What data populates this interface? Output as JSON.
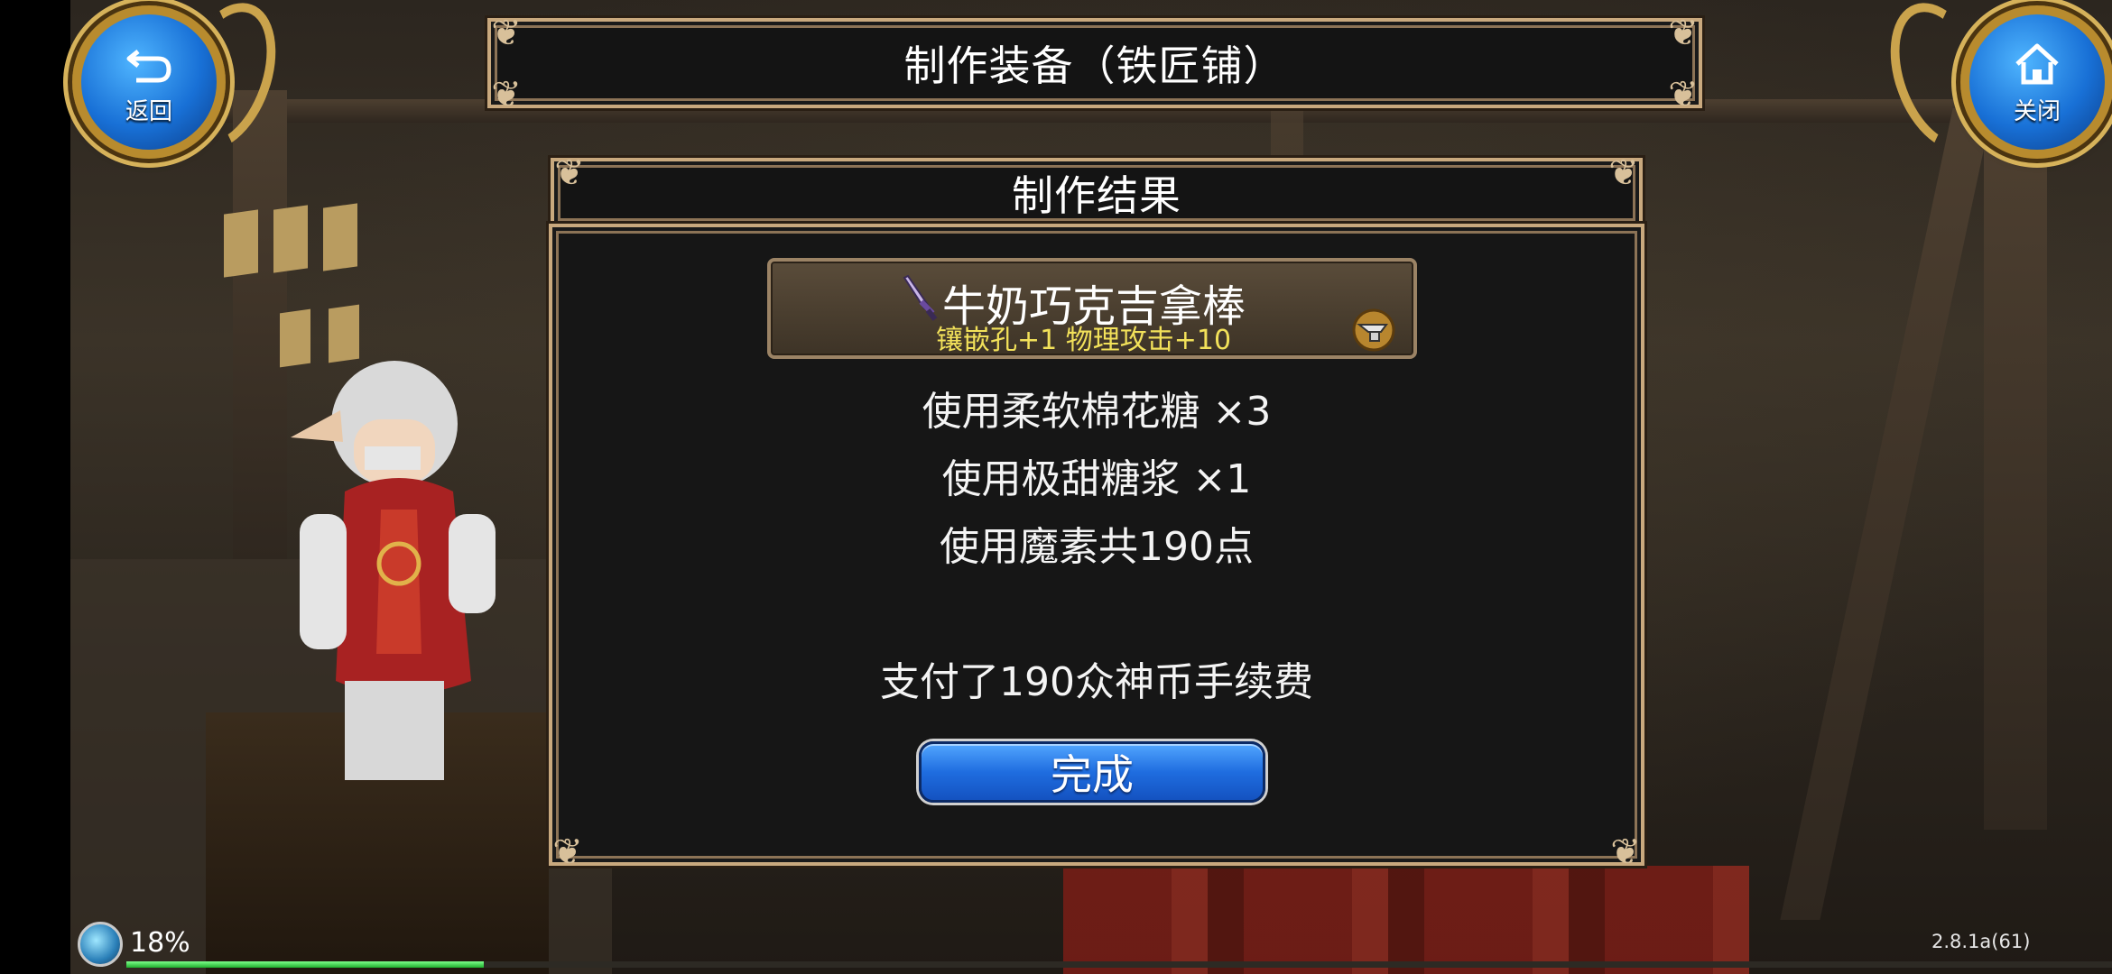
{
  "top_bar": {
    "back_label": "返回",
    "close_label": "关闭",
    "title": "制作装备（铁匠铺）"
  },
  "result_panel": {
    "heading": "制作结果",
    "item": {
      "name": "牛奶巧克吉拿棒",
      "attributes": "镶嵌孔+1 物理攻击+10",
      "icon": "sword-icon",
      "badge_icon": "anvil-icon"
    },
    "lines": [
      "使用柔软棉花糖 ×3",
      "使用极甜糖浆 ×1",
      "使用魔素共190点"
    ],
    "fee_text": "支付了190众神币手续费",
    "done_label": "完成"
  },
  "hud": {
    "exp_percent_label": "18%",
    "exp_fraction": 0.18,
    "version": "2.8.1a(61)"
  },
  "colors": {
    "frame_border": "#c9a97e",
    "button_blue": "#1f6de0",
    "attr_yellow": "#f2e15a",
    "exp_green": "#1fae2d"
  }
}
